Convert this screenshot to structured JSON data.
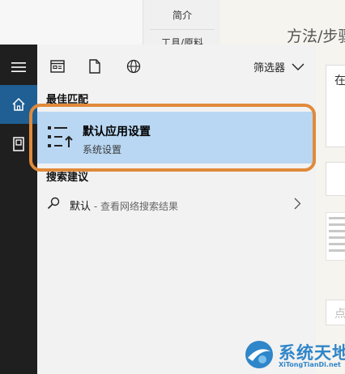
{
  "background": {
    "tabs": [
      "简介",
      "工具/原料"
    ],
    "section_title": "方法/步骤",
    "step_text": "在",
    "placeholder_char": "点"
  },
  "sidebar": {
    "items": [
      {
        "icon": "hamburger-menu-icon"
      },
      {
        "icon": "home-icon",
        "active": true
      },
      {
        "icon": "document-icon"
      }
    ],
    "accent_color": "#1f5f93"
  },
  "toolbar": {
    "icons": [
      "apps-icon",
      "documents-icon",
      "web-icon"
    ],
    "filter_label": "筛选器"
  },
  "best_match": {
    "heading": "最佳匹配",
    "title": "默认应用设置",
    "subtitle": "系统设置",
    "icon": "default-apps-icon",
    "highlight_color": "#b9d7f2"
  },
  "web_suggestions": {
    "heading": "搜索建议",
    "items": [
      {
        "query": "默认",
        "hint": " - 查看网络搜索结果"
      }
    ]
  },
  "annotation": {
    "color": "#e08a3a"
  },
  "watermark": {
    "title": "系统天地",
    "url": "XiTongTianDi.net"
  }
}
